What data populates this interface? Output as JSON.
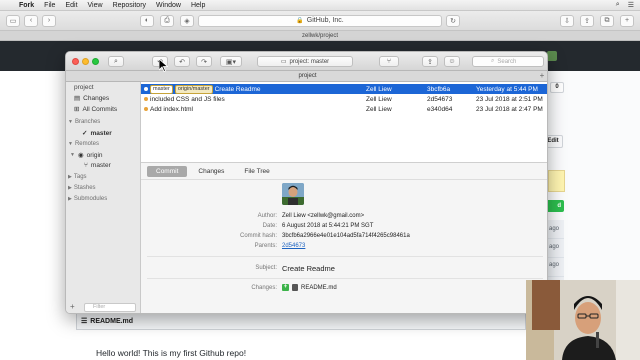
{
  "menubar": {
    "app_name": "Fork",
    "items": [
      "File",
      "Edit",
      "View",
      "Repository",
      "Window",
      "Help"
    ]
  },
  "browser": {
    "url_host": "GitHub, Inc.",
    "tab_title": "zellwk/project"
  },
  "github": {
    "right_badge": "0",
    "edit_label": "Edit",
    "green_button_label": "d",
    "ages": [
      "ago",
      "ago",
      "ago",
      "ago"
    ],
    "readme_title": "README.md",
    "readme_text": "Hello world! This is my first Github repo!"
  },
  "fork": {
    "repo_select": "project: master",
    "search_placeholder": "Search",
    "tab_label": "project",
    "sidebar": {
      "repo_title": "project",
      "changes": "Changes",
      "all_commits": "All Commits",
      "branches_header": "Branches",
      "branch_master": "master",
      "remotes_header": "Remotes",
      "remote_origin": "origin",
      "remote_master": "master",
      "tags_header": "Tags",
      "stashes_header": "Stashes",
      "submodules_header": "Submodules",
      "filter_placeholder": "Filter"
    },
    "commits": [
      {
        "tags": [
          "master",
          "origin/master"
        ],
        "message": "Create Readme",
        "author": "Zell Liew",
        "sha": "3bcfb6a",
        "date": "Yesterday at 5:44 PM",
        "selected": true
      },
      {
        "tags": [],
        "message": "included CSS and JS files",
        "author": "Zell Liew",
        "sha": "2d54673",
        "date": "23 Jul 2018 at 2:51 PM",
        "selected": false
      },
      {
        "tags": [],
        "message": "Add index.html",
        "author": "Zell Liew",
        "sha": "e340d64",
        "date": "23 Jul 2018 at 2:47 PM",
        "selected": false
      }
    ],
    "detail": {
      "tabs": [
        "Commit",
        "Changes",
        "File Tree"
      ],
      "active_tab": "Commit",
      "author_label": "Author:",
      "author_value": "Zell Liew <zellwk@gmail.com>",
      "date_label": "Date:",
      "date_value": "6 August 2018 at 5:44:21 PM SGT",
      "hash_label": "Commit hash:",
      "hash_value": "3bcfb6a2966e4e01e104ad5fa714f4265c98461a",
      "parents_label": "Parents:",
      "parents_value": "2d54673",
      "subject_label": "Subject:",
      "subject_value": "Create Readme",
      "changes_label": "Changes:",
      "changed_file": "README.md"
    }
  }
}
